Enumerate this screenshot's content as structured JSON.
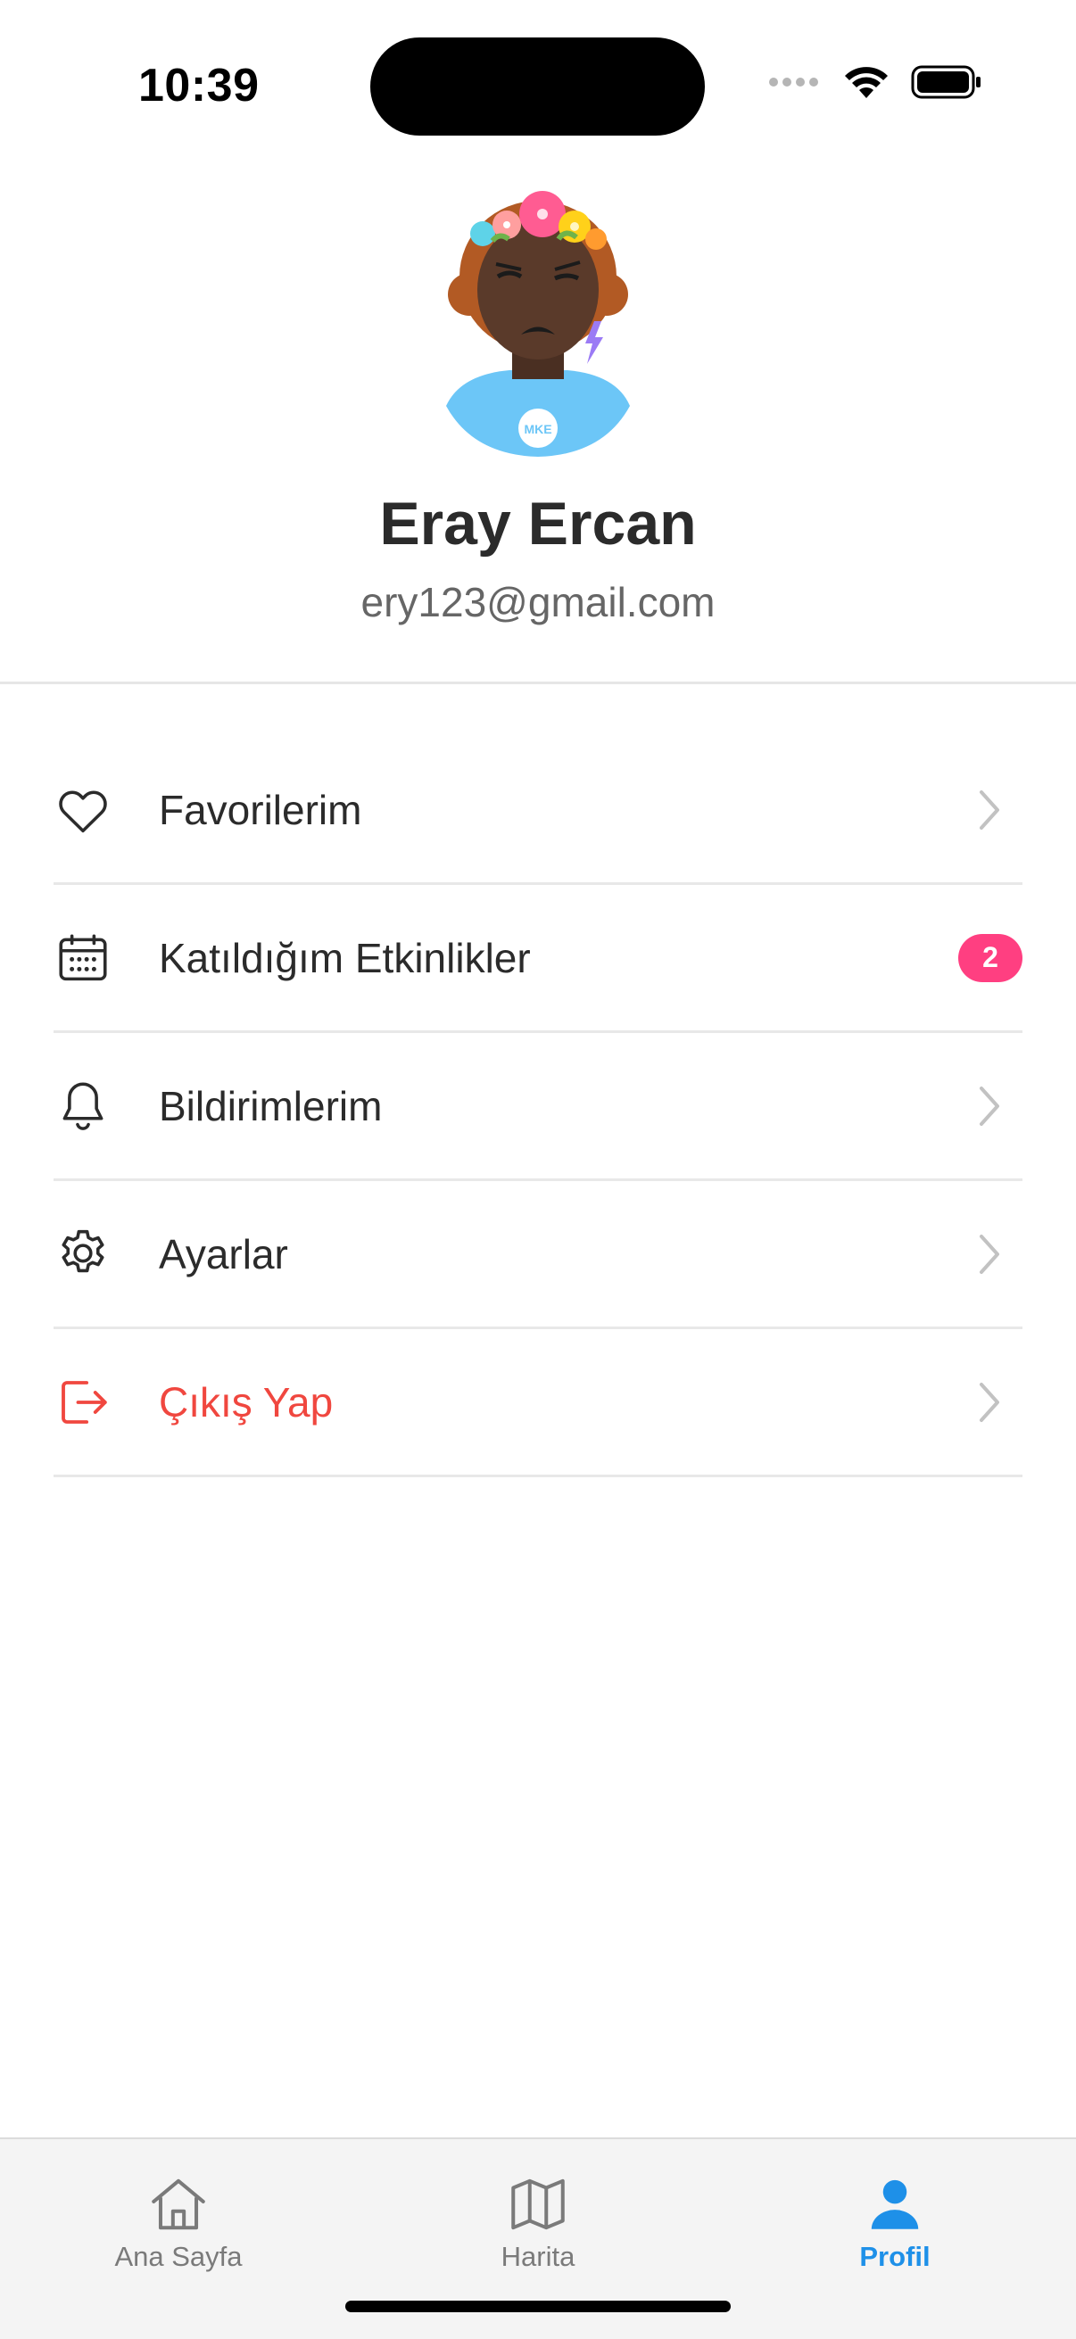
{
  "status_bar": {
    "time": "10:39"
  },
  "profile": {
    "name": "Eray Ercan",
    "email": "ery123@gmail.com",
    "avatar_badge_text": "MKE"
  },
  "menu": {
    "items": [
      {
        "label": "Favorilerim",
        "icon": "heart-icon"
      },
      {
        "label": "Katıldığım Etkinlikler",
        "icon": "calendar-icon",
        "badge": "2"
      },
      {
        "label": "Bildirimlerim",
        "icon": "bell-icon"
      },
      {
        "label": "Ayarlar",
        "icon": "gear-icon"
      },
      {
        "label": "Çıkış Yap",
        "icon": "logout-icon",
        "color": "#f0473f"
      }
    ]
  },
  "tabbar": {
    "tabs": [
      {
        "label": "Ana Sayfa",
        "icon": "home-icon"
      },
      {
        "label": "Harita",
        "icon": "map-icon"
      },
      {
        "label": "Profil",
        "icon": "person-icon",
        "active": true
      }
    ]
  },
  "colors": {
    "accent": "#1e90e8",
    "danger": "#f0473f",
    "badge": "#ff3f81"
  }
}
